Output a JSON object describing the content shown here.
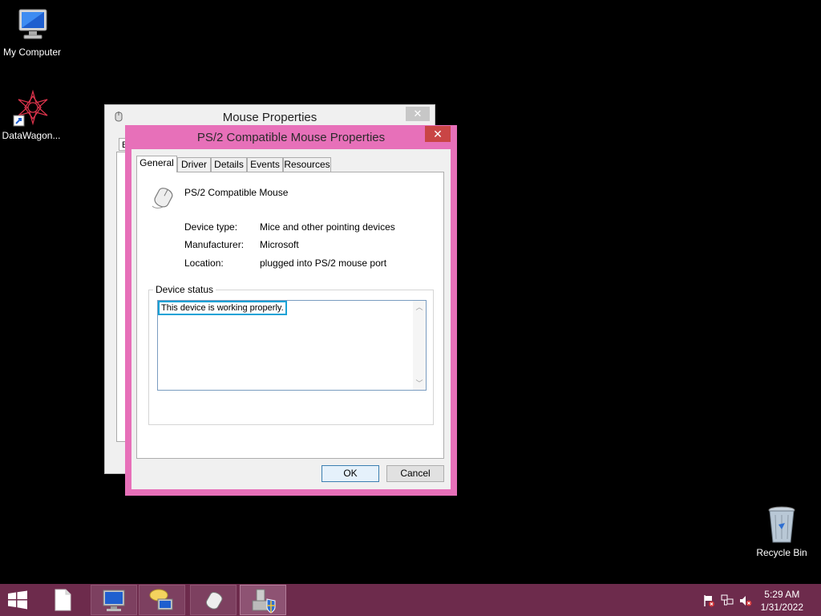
{
  "desktop": {
    "icons": [
      {
        "label": "My Computer"
      },
      {
        "label": "DataWagon..."
      },
      {
        "label": "Recycle Bin"
      }
    ]
  },
  "back_window": {
    "title": "Mouse Properties",
    "close_label": "✕",
    "tab_stub": "B"
  },
  "dialog": {
    "title": "PS/2 Compatible Mouse Properties",
    "close_label": "✕",
    "tabs": [
      {
        "label": "General",
        "active": true
      },
      {
        "label": "Driver"
      },
      {
        "label": "Details"
      },
      {
        "label": "Events"
      },
      {
        "label": "Resources"
      }
    ],
    "device_name": "PS/2 Compatible Mouse",
    "properties": [
      {
        "label": "Device type:",
        "value": "Mice and other pointing devices"
      },
      {
        "label": "Manufacturer:",
        "value": "Microsoft"
      },
      {
        "label": "Location:",
        "value": "plugged into PS/2 mouse port"
      }
    ],
    "status_group_title": "Device status",
    "status_text": "This device is working properly.",
    "ok_label": "OK",
    "cancel_label": "Cancel"
  },
  "taskbar": {
    "time": "5:29 AM",
    "date": "1/31/2022",
    "buttons": [
      "start-button",
      "file-icon",
      "my-computer-icon",
      "network-chat-icon",
      "mouse-icon",
      "device-manager-icon"
    ],
    "tray": [
      "action-center-flag-icon",
      "network-icon",
      "volume-muted-icon"
    ]
  },
  "colors": {
    "dialog_frame": "#e770b9",
    "taskbar": "#6d2b4c",
    "close_button": "#c94545",
    "focus_outline": "#1aa2d6"
  }
}
